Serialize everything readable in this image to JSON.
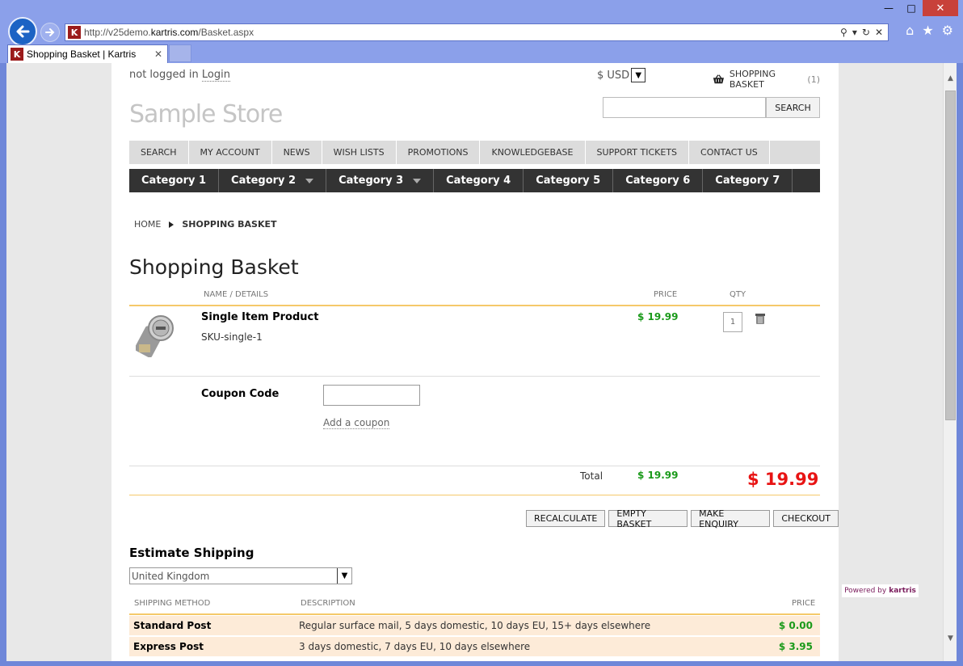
{
  "browser": {
    "url_prefix": "http://v25demo.",
    "url_domain": "kartris.com",
    "url_path": "/Basket.aspx",
    "tab_title": "Shopping Basket | Kartris",
    "favicon_letter": "K"
  },
  "header": {
    "login_text": "not logged in",
    "login_link": "Login",
    "currency": "$ USD",
    "basket_label": "SHOPPING BASKET",
    "basket_count": "(1)",
    "logo": "Sample Store",
    "search_button": "SEARCH"
  },
  "menu": [
    "SEARCH",
    "MY ACCOUNT",
    "NEWS",
    "WISH LISTS",
    "PROMOTIONS",
    "KNOWLEDGEBASE",
    "SUPPORT TICKETS",
    "CONTACT US"
  ],
  "categories": [
    {
      "label": "Category 1",
      "has_sub": false
    },
    {
      "label": "Category 2",
      "has_sub": true
    },
    {
      "label": "Category 3",
      "has_sub": true
    },
    {
      "label": "Category 4",
      "has_sub": false
    },
    {
      "label": "Category 5",
      "has_sub": false
    },
    {
      "label": "Category 6",
      "has_sub": false
    },
    {
      "label": "Category 7",
      "has_sub": false
    }
  ],
  "breadcrumb": {
    "home": "HOME",
    "current": "SHOPPING BASKET"
  },
  "basket": {
    "title": "Shopping Basket",
    "col_name": "NAME / DETAILS",
    "col_price": "PRICE",
    "col_qty": "QTY",
    "item": {
      "name": "Single Item Product",
      "sku": "SKU-single-1",
      "price": "$ 19.99",
      "qty": "1"
    },
    "coupon_label": "Coupon Code",
    "coupon_link": "Add a coupon",
    "total_label": "Total",
    "total_price": "$ 19.99",
    "grand_total": "$ 19.99",
    "buttons": {
      "recalculate": "RECALCULATE",
      "empty": "EMPTY BASKET",
      "enquiry": "MAKE ENQUIRY",
      "checkout": "CHECKOUT"
    }
  },
  "shipping": {
    "title": "Estimate Shipping",
    "country": "United Kingdom",
    "col_method": "SHIPPING METHOD",
    "col_desc": "DESCRIPTION",
    "col_price": "PRICE",
    "rows": [
      {
        "method": "Standard Post",
        "desc": "Regular surface mail, 5 days domestic, 10 days EU, 15+ days elsewhere",
        "price": "$ 0.00"
      },
      {
        "method": "Express Post",
        "desc": "3 days domestic, 7 days EU, 10 days elsewhere",
        "price": "$ 3.95"
      }
    ]
  },
  "footer": {
    "powered_by": "Powered by",
    "brand": "kartris"
  },
  "colors": {
    "accent_orange": "#f5c96a",
    "price_green": "#1a9a1a",
    "total_red": "#e81414",
    "category_bar": "#333333",
    "shipping_row": "#fdebd8"
  }
}
